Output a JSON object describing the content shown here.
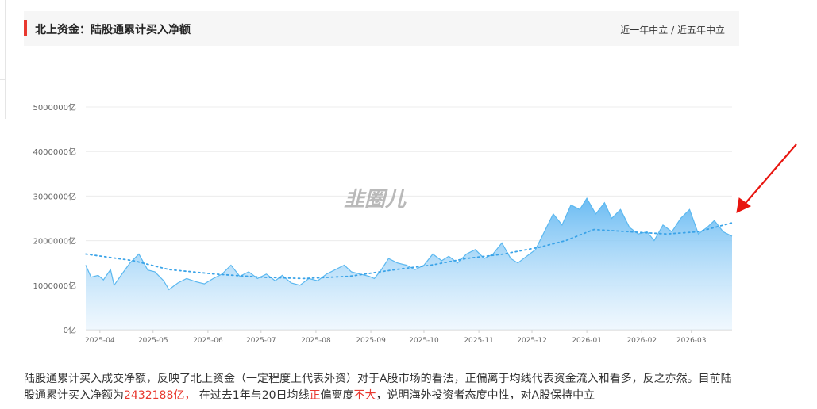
{
  "header": {
    "title": "北上资金：陆股通累计买入净额",
    "link_year": "近一年中立",
    "link_sep": " / ",
    "link_five": "近五年中立"
  },
  "watermark": "韭圈儿",
  "colors": {
    "accent": "#e8382f",
    "area_stroke": "#5bb8f0",
    "area_fill_top": "#63b8f2",
    "area_fill_bottom": "#e6f3fd",
    "ma_line": "#3aa3e8",
    "arrow": "#e8150f"
  },
  "chart_data": {
    "type": "area",
    "unit": "亿",
    "ylim": [
      0,
      5000000
    ],
    "y_ticks": [
      "0亿",
      "1000000亿",
      "2000000亿",
      "3000000亿",
      "4000000亿",
      "5000000亿"
    ],
    "x_ticks": [
      "2025-04",
      "2025-05",
      "2025-06",
      "2025-07",
      "2025-08",
      "2025-09",
      "2025-10",
      "2025-11",
      "2025-12",
      "2026-01",
      "2026-02",
      "2026-03"
    ],
    "grid": true,
    "series": [
      {
        "type": "area",
        "points": [
          [
            "2025-03-24",
            1450000
          ],
          [
            "2025-03-27",
            1180000
          ],
          [
            "2025-03-31",
            1220000
          ],
          [
            "2025-04-03",
            1120000
          ],
          [
            "2025-04-07",
            1350000
          ],
          [
            "2025-04-09",
            1000000
          ],
          [
            "2025-04-14",
            1280000
          ],
          [
            "2025-04-18",
            1500000
          ],
          [
            "2025-04-23",
            1700000
          ],
          [
            "2025-04-28",
            1340000
          ],
          [
            "2025-05-02",
            1300000
          ],
          [
            "2025-05-07",
            1100000
          ],
          [
            "2025-05-10",
            900000
          ],
          [
            "2025-05-15",
            1050000
          ],
          [
            "2025-05-20",
            1150000
          ],
          [
            "2025-05-25",
            1080000
          ],
          [
            "2025-05-30",
            1030000
          ],
          [
            "2025-06-04",
            1150000
          ],
          [
            "2025-06-09",
            1250000
          ],
          [
            "2025-06-14",
            1450000
          ],
          [
            "2025-06-19",
            1200000
          ],
          [
            "2025-06-24",
            1300000
          ],
          [
            "2025-06-29",
            1150000
          ],
          [
            "2025-07-04",
            1250000
          ],
          [
            "2025-07-09",
            1100000
          ],
          [
            "2025-07-13",
            1220000
          ],
          [
            "2025-07-18",
            1050000
          ],
          [
            "2025-07-23",
            1000000
          ],
          [
            "2025-07-28",
            1150000
          ],
          [
            "2025-08-02",
            1100000
          ],
          [
            "2025-08-07",
            1250000
          ],
          [
            "2025-08-12",
            1350000
          ],
          [
            "2025-08-17",
            1450000
          ],
          [
            "2025-08-21",
            1300000
          ],
          [
            "2025-08-26",
            1250000
          ],
          [
            "2025-08-31",
            1200000
          ],
          [
            "2025-09-03",
            1150000
          ],
          [
            "2025-09-07",
            1350000
          ],
          [
            "2025-09-11",
            1600000
          ],
          [
            "2025-09-16",
            1500000
          ],
          [
            "2025-09-21",
            1450000
          ],
          [
            "2025-09-26",
            1350000
          ],
          [
            "2025-10-01",
            1450000
          ],
          [
            "2025-10-06",
            1700000
          ],
          [
            "2025-10-11",
            1550000
          ],
          [
            "2025-10-15",
            1650000
          ],
          [
            "2025-10-20",
            1500000
          ],
          [
            "2025-10-25",
            1700000
          ],
          [
            "2025-10-30",
            1800000
          ],
          [
            "2025-11-04",
            1600000
          ],
          [
            "2025-11-09",
            1700000
          ],
          [
            "2025-11-14",
            1950000
          ],
          [
            "2025-11-19",
            1600000
          ],
          [
            "2025-11-23",
            1500000
          ],
          [
            "2025-11-28",
            1650000
          ],
          [
            "2025-12-03",
            1800000
          ],
          [
            "2025-12-08",
            2200000
          ],
          [
            "2025-12-13",
            2600000
          ],
          [
            "2025-12-18",
            2350000
          ],
          [
            "2025-12-23",
            2800000
          ],
          [
            "2025-12-28",
            2700000
          ],
          [
            "2026-01-01",
            2950000
          ],
          [
            "2026-01-06",
            2600000
          ],
          [
            "2026-01-11",
            2850000
          ],
          [
            "2026-01-15",
            2500000
          ],
          [
            "2026-01-20",
            2700000
          ],
          [
            "2026-01-25",
            2300000
          ],
          [
            "2026-01-30",
            2150000
          ],
          [
            "2026-02-04",
            2200000
          ],
          [
            "2026-02-08",
            2000000
          ],
          [
            "2026-02-13",
            2350000
          ],
          [
            "2026-02-18",
            2200000
          ],
          [
            "2026-02-23",
            2500000
          ],
          [
            "2026-02-28",
            2700000
          ],
          [
            "2026-03-05",
            2150000
          ],
          [
            "2026-03-10",
            2300000
          ],
          [
            "2026-03-14",
            2450000
          ],
          [
            "2026-03-19",
            2200000
          ],
          [
            "2026-03-24",
            2100000
          ]
        ]
      },
      {
        "type": "dotted-line",
        "points": [
          [
            "2025-03-24",
            1700000
          ],
          [
            "2025-04-20",
            1550000
          ],
          [
            "2025-05-10",
            1350000
          ],
          [
            "2025-06-05",
            1250000
          ],
          [
            "2025-07-01",
            1180000
          ],
          [
            "2025-07-25",
            1150000
          ],
          [
            "2025-08-20",
            1200000
          ],
          [
            "2025-09-15",
            1350000
          ],
          [
            "2025-10-05",
            1450000
          ],
          [
            "2025-10-25",
            1600000
          ],
          [
            "2025-11-15",
            1700000
          ],
          [
            "2025-12-05",
            1850000
          ],
          [
            "2025-12-20",
            2000000
          ],
          [
            "2026-01-05",
            2250000
          ],
          [
            "2026-01-25",
            2200000
          ],
          [
            "2026-02-15",
            2150000
          ],
          [
            "2026-03-05",
            2200000
          ],
          [
            "2026-03-24",
            2400000
          ]
        ]
      }
    ]
  },
  "description": {
    "line1": "陆股通累计买入成交净额，反映了北上资金（一定程度上代表外资）对于A股市场的看法，正偏离于均线代表资金流入和看多，反之亦然。目前陆股通累计买入净额为",
    "value": "2432188亿，",
    "part2": " 在过去1年与20日均线",
    "dir": "正",
    "part3": "偏离度",
    "degree": "不大",
    "part4": "，说明海外投资者态度中性，对A股保持中立"
  }
}
